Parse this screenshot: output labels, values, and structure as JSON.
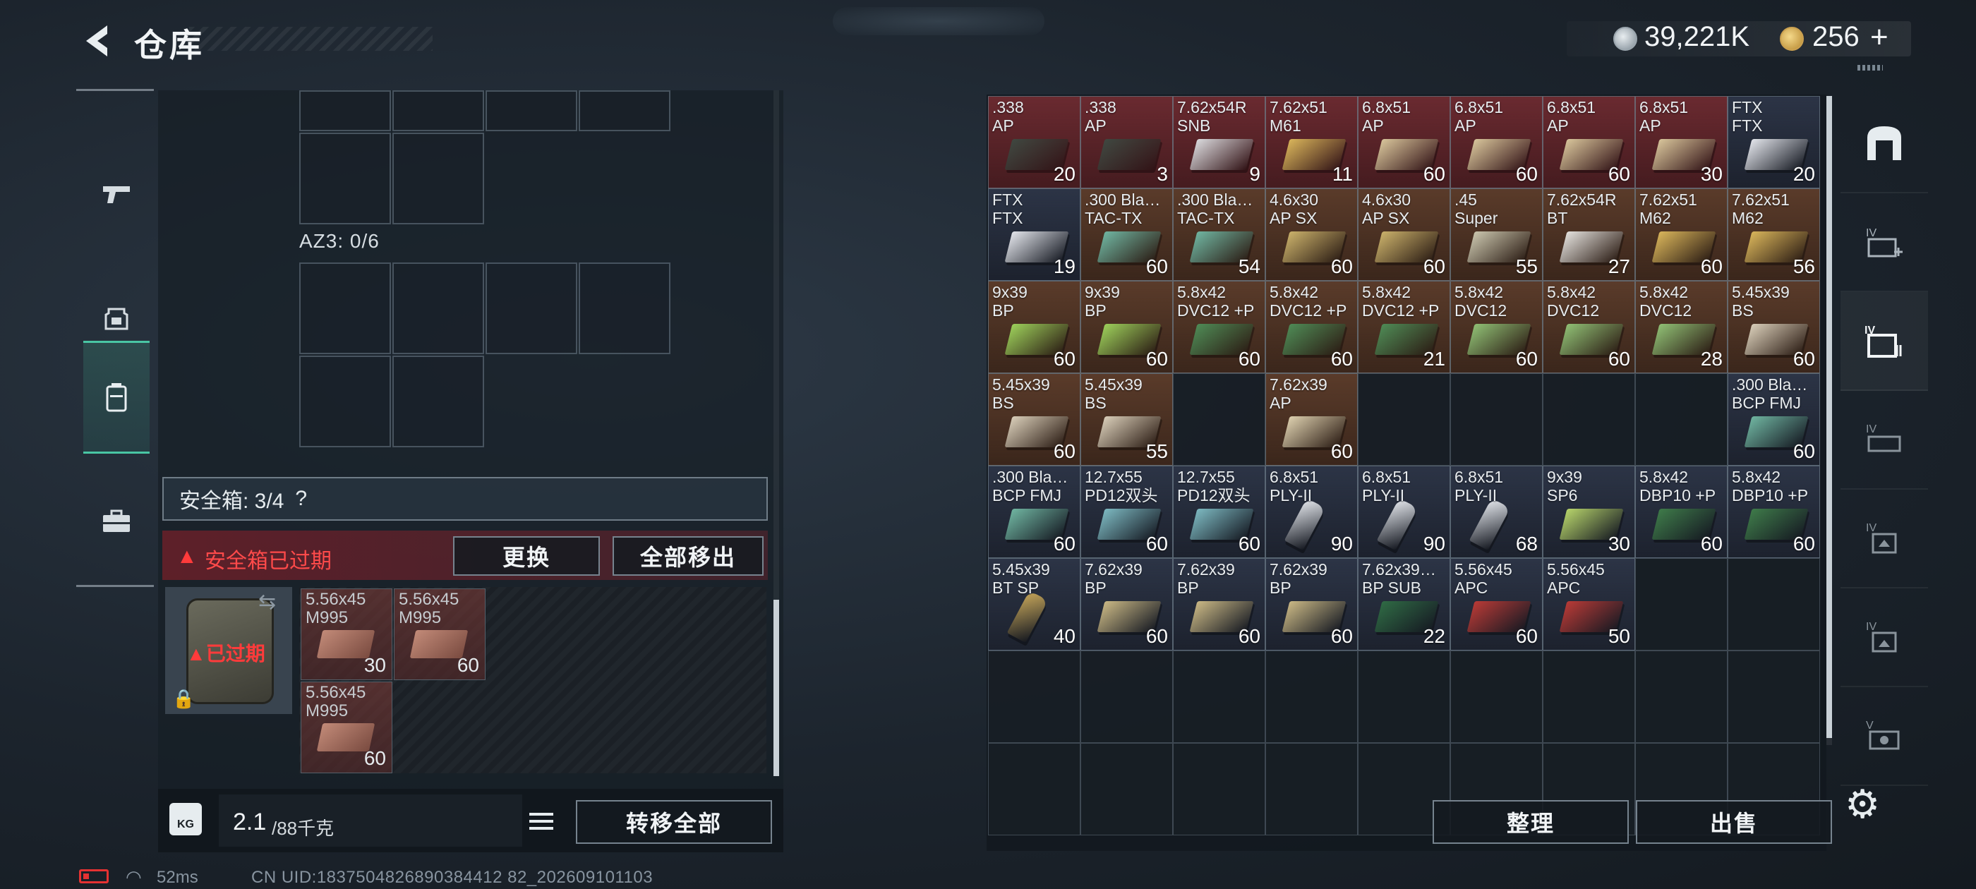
{
  "header": {
    "title": "仓库",
    "currency": {
      "coin_value": "39,221K",
      "token_value": "256",
      "token_plus": "+"
    }
  },
  "left_nav": {
    "items": [
      {
        "name": "weapons",
        "icon": "pistol-icon",
        "active": false
      },
      {
        "name": "armor",
        "icon": "helmet-icon",
        "active": false
      },
      {
        "name": "backpack",
        "icon": "backpack-icon",
        "active": true
      },
      {
        "name": "case",
        "icon": "briefcase-icon",
        "active": false
      }
    ]
  },
  "loadout": {
    "az3_label": "AZ3: 0/6",
    "safe_box": {
      "label": "安全箱: 3/4",
      "help": "?"
    },
    "expired_banner": {
      "text": "安全箱已过期",
      "swap_label": "更换",
      "move_all_label": "全部移出"
    },
    "case_status": "已过期",
    "case_items": [
      {
        "name": "5.56x45\nM995",
        "count": "30"
      },
      {
        "name": "5.56x45\nM995",
        "count": "60"
      },
      {
        "name": "5.56x45\nM995",
        "count": "60"
      }
    ],
    "weight": {
      "current": "2.1",
      "max": "/88千克",
      "unit_icon": "KG"
    },
    "transfer_all_label": "转移全部"
  },
  "stash": {
    "rows": [
      [
        {
          "name": ".338\nAP",
          "count": "20",
          "bg": "#6a2a30",
          "art": "#3f4740"
        },
        {
          "name": ".338\nAP",
          "count": "3",
          "bg": "#6a2a30",
          "art": "#3f4740"
        },
        {
          "name": "7.62x54R\nSNB",
          "count": "9",
          "bg": "#6a2a30",
          "art": "#d9d9dc"
        },
        {
          "name": "7.62x51\nM61",
          "count": "11",
          "bg": "#6a2a30",
          "art": "#d8b45a"
        },
        {
          "name": "6.8x51\nAP",
          "count": "60",
          "bg": "#6a2a30",
          "art": "#d7c49a"
        },
        {
          "name": "6.8x51\nAP",
          "count": "60",
          "bg": "#6a2a30",
          "art": "#d7c49a"
        },
        {
          "name": "6.8x51\nAP",
          "count": "60",
          "bg": "#6a2a30",
          "art": "#d7c49a"
        },
        {
          "name": "6.8x51\nAP",
          "count": "30",
          "bg": "#6a2a30",
          "art": "#d7c49a"
        },
        {
          "name": "FTX\nFTX",
          "count": "20",
          "bg": "#2c3446",
          "art": "#e2e4ea"
        }
      ],
      [
        {
          "name": "FTX\nFTX",
          "count": "19",
          "bg": "#2c3446",
          "art": "#e2e4ea"
        },
        {
          "name": ".300 Bla…\nTAC-TX",
          "count": "60",
          "bg": "#5a3b2a",
          "art": "#6fb4a0"
        },
        {
          "name": ".300 Bla…\nTAC-TX",
          "count": "54",
          "bg": "#5a3b2a",
          "art": "#6fb4a0"
        },
        {
          "name": "4.6x30\nAP SX",
          "count": "60",
          "bg": "#5a3b2a",
          "art": "#c9b06a"
        },
        {
          "name": "4.6x30\nAP SX",
          "count": "60",
          "bg": "#5a3b2a",
          "art": "#c9b06a"
        },
        {
          "name": ".45\nSuper",
          "count": "55",
          "bg": "#5a3b2a",
          "art": "#c9c5ad"
        },
        {
          "name": "7.62x54R\nBT",
          "count": "27",
          "bg": "#5a3b2a",
          "art": "#e2e0dc"
        },
        {
          "name": "7.62x51\nM62",
          "count": "60",
          "bg": "#5a3b2a",
          "art": "#d8b45a"
        },
        {
          "name": "7.62x51\nM62",
          "count": "56",
          "bg": "#5a3b2a",
          "art": "#d8b45a"
        }
      ],
      [
        {
          "name": "9x39\nBP",
          "count": "60",
          "bg": "#5a3b2a",
          "art": "#9ccf5a"
        },
        {
          "name": "9x39\nBP",
          "count": "60",
          "bg": "#5a3b2a",
          "art": "#9ccf5a"
        },
        {
          "name": "5.8x42\nDVC12 +P",
          "count": "60",
          "bg": "#5a3b2a",
          "art": "#4e8a55"
        },
        {
          "name": "5.8x42\nDVC12 +P",
          "count": "60",
          "bg": "#5a3b2a",
          "art": "#4e8a55"
        },
        {
          "name": "5.8x42\nDVC12 +P",
          "count": "21",
          "bg": "#5a3b2a",
          "art": "#4e8a55"
        },
        {
          "name": "5.8x42\nDVC12",
          "count": "60",
          "bg": "#5a3b2a",
          "art": "#8fbf74"
        },
        {
          "name": "5.8x42\nDVC12",
          "count": "60",
          "bg": "#5a3b2a",
          "art": "#8fbf74"
        },
        {
          "name": "5.8x42\nDVC12",
          "count": "28",
          "bg": "#5a3b2a",
          "art": "#8fbf74"
        },
        {
          "name": "5.45x39\nBS",
          "count": "60",
          "bg": "#5a3b2a",
          "art": "#d8cdb8"
        }
      ],
      [
        {
          "name": "5.45x39\nBS",
          "count": "60",
          "bg": "#5a3b2a",
          "art": "#d8cdb8"
        },
        {
          "name": "5.45x39\nBS",
          "count": "55",
          "bg": "#5a3b2a",
          "art": "#d8cdb8"
        },
        null,
        {
          "name": "7.62x39\nAP",
          "count": "60",
          "bg": "#5a3b2a",
          "art": "#dccfae"
        },
        null,
        null,
        null,
        null,
        {
          "name": ".300 Bla…\nBCP FMJ",
          "count": "60",
          "bg": "#2c3446",
          "art": "#6fb4a0"
        }
      ],
      [
        {
          "name": ".300 Bla…\nBCP FMJ",
          "count": "60",
          "bg": "#2c3446",
          "art": "#6fb4a0"
        },
        {
          "name": "12.7x55\nPD12双头",
          "count": "60",
          "bg": "#2c3446",
          "art": "#7cb8c0"
        },
        {
          "name": "12.7x55\nPD12双头",
          "count": "60",
          "bg": "#2c3446",
          "art": "#7cb8c0"
        },
        {
          "name": "6.8x51\nPLY-II",
          "count": "90",
          "bg": "#2c3446",
          "art": "#e6e9ee",
          "round": true
        },
        {
          "name": "6.8x51\nPLY-II",
          "count": "90",
          "bg": "#2c3446",
          "art": "#e6e9ee",
          "round": true
        },
        {
          "name": "6.8x51\nPLY-II",
          "count": "68",
          "bg": "#2c3446",
          "art": "#e6e9ee",
          "round": true
        },
        {
          "name": "9x39\nSP6",
          "count": "30",
          "bg": "#2c3446",
          "art": "#b6d36a"
        },
        {
          "name": "5.8x42\nDBP10 +P",
          "count": "60",
          "bg": "#2c3446",
          "art": "#3e7a49"
        },
        {
          "name": "5.8x42\nDBP10 +P",
          "count": "60",
          "bg": "#2c3446",
          "art": "#3e7a49"
        }
      ],
      [
        {
          "name": "5.45x39\nBT SP",
          "count": "40",
          "bg": "#2c3446",
          "art": "#c9a85a",
          "round": true
        },
        {
          "name": "7.62x39\nBP",
          "count": "60",
          "bg": "#2c3446",
          "art": "#c9b784"
        },
        {
          "name": "7.62x39\nBP",
          "count": "60",
          "bg": "#2c3446",
          "art": "#c9b784"
        },
        {
          "name": "7.62x39\nBP",
          "count": "60",
          "bg": "#2c3446",
          "art": "#c9b784"
        },
        {
          "name": "7.62x39…\nBP SUB",
          "count": "22",
          "bg": "#2c3446",
          "art": "#2f6a44"
        },
        {
          "name": "5.56x45\nAPC",
          "count": "60",
          "bg": "#2c3446",
          "art": "#b83a36"
        },
        {
          "name": "5.56x45\nAPC",
          "count": "50",
          "bg": "#2c3446",
          "art": "#b83a36"
        },
        null,
        null
      ]
    ],
    "sort_label": "整理",
    "sell_label": "出售"
  },
  "right_nav": {
    "items": [
      "stash-icon",
      "add-container-icon",
      "container-list-icon",
      "container-3-icon",
      "container-4-icon",
      "container-5-icon",
      "container-6-icon"
    ]
  },
  "status_bar": {
    "ping": "52ms",
    "uid": "CN UID:1837504826890384412 82_202609101103"
  }
}
